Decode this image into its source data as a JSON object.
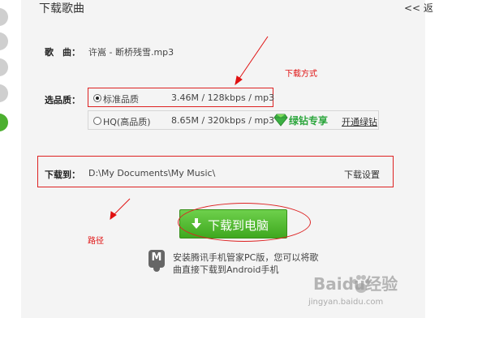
{
  "header": {
    "title": "下载歌曲",
    "back": "<< 返"
  },
  "song": {
    "label": "歌　曲：",
    "value": "许嵩 - 断桥残雪.mp3"
  },
  "quality": {
    "label": "选品质：",
    "standard": {
      "name": "标准品质",
      "detail": "3.46M / 128kbps / mp3",
      "selected": true
    },
    "hq": {
      "name": "HQ(高品质)",
      "detail": "8.65M / 320kbps / mp3",
      "selected": false
    },
    "vip_badge": "绿钻专享",
    "open_vip": "开通绿钻"
  },
  "download_to": {
    "label": "下载到：",
    "path": "D:\\My Documents\\My Music\\",
    "settings": "下载设置"
  },
  "download_button": {
    "label": "下载到电脑",
    "icon": "arrow-down-icon"
  },
  "promo": {
    "line1": "安装腾讯手机管家PC版，您可以将歌",
    "line2": "曲直接下载到Android手机"
  },
  "annotations": {
    "download_method": "下载方式",
    "path_note": "路径"
  },
  "watermark": {
    "brand": "Baidu经验",
    "sub": "jingyan.baidu.com"
  },
  "colors": {
    "accent_green": "#4caf2f",
    "annotation_red": "#e01010",
    "vip_green": "#2aa53b"
  }
}
